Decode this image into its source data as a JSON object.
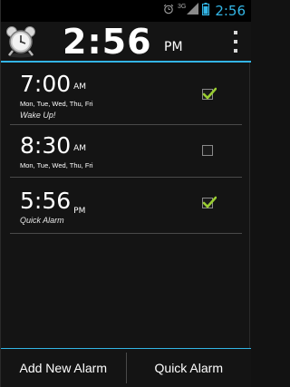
{
  "status_bar": {
    "time": "2:56",
    "network": "3G",
    "icons": [
      "alarm-icon",
      "signal-icon",
      "battery-icon"
    ],
    "accent_color": "#33b5e5"
  },
  "header": {
    "time": "2:56",
    "ampm": "PM",
    "app_icon": "alarm-clock-icon",
    "menu_icon": "overflow-menu-icon"
  },
  "alarms": [
    {
      "time": "7:00",
      "ampm": "AM",
      "days": "Mon, Tue, Wed, Thu, Fri",
      "label": "Wake Up!",
      "enabled": true
    },
    {
      "time": "8:30",
      "ampm": "AM",
      "days": "Mon, Tue, Wed, Thu, Fri",
      "label": "",
      "enabled": false
    },
    {
      "time": "5:56",
      "ampm": "PM",
      "days": "",
      "label": "Quick Alarm",
      "enabled": true
    }
  ],
  "bottom_bar": {
    "add_label": "Add New Alarm",
    "quick_label": "Quick Alarm"
  },
  "colors": {
    "accent": "#33b5e5",
    "check": "#9acd32",
    "background": "#141414"
  }
}
